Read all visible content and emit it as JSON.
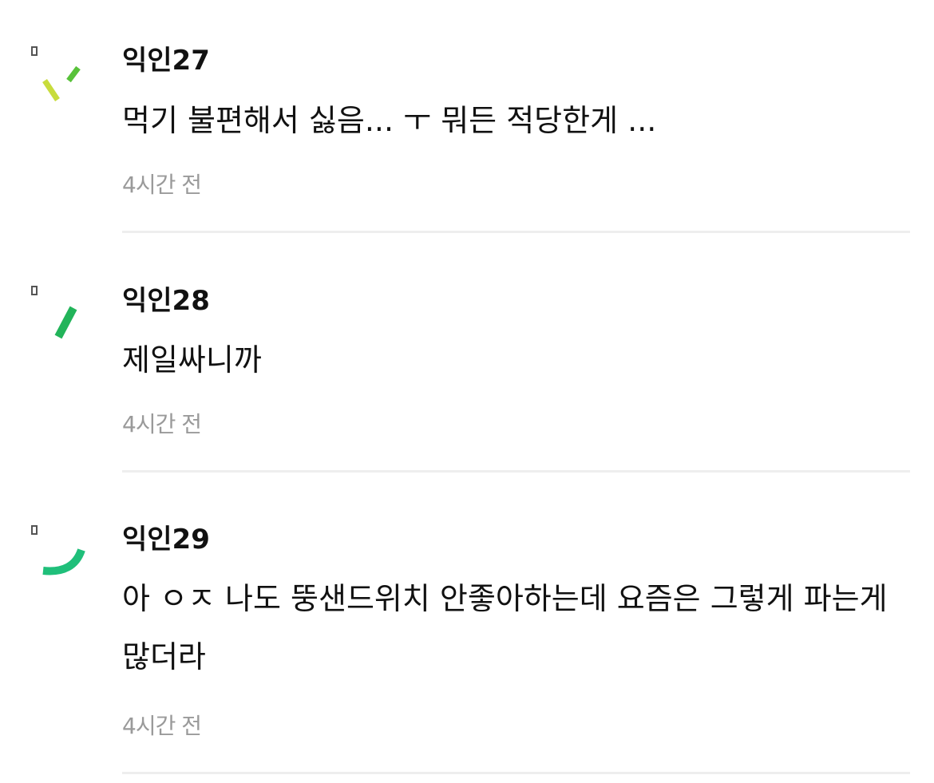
{
  "comments": [
    {
      "author": "익인27",
      "text": "먹기 불편해서 싫음... ㅜ 뭐든 적당한게 ...",
      "time": "4시간 전",
      "avatar_icon": "confetti-lines-icon",
      "avatar_colors": [
        "#c8dc3c",
        "#58c23a"
      ]
    },
    {
      "author": "익인28",
      "text": "제일싸니까",
      "time": "4시간 전",
      "avatar_icon": "confetti-line-icon",
      "avatar_colors": [
        "#22b45a"
      ]
    },
    {
      "author": "익인29",
      "text": "아 ㅇㅈ 나도 뚱샌드위치 안좋아하는데 요즘은 그렇게 파는게 많더라",
      "time": "4시간 전",
      "avatar_icon": "confetti-arc-icon",
      "avatar_colors": [
        "#1fbf7a"
      ]
    }
  ]
}
